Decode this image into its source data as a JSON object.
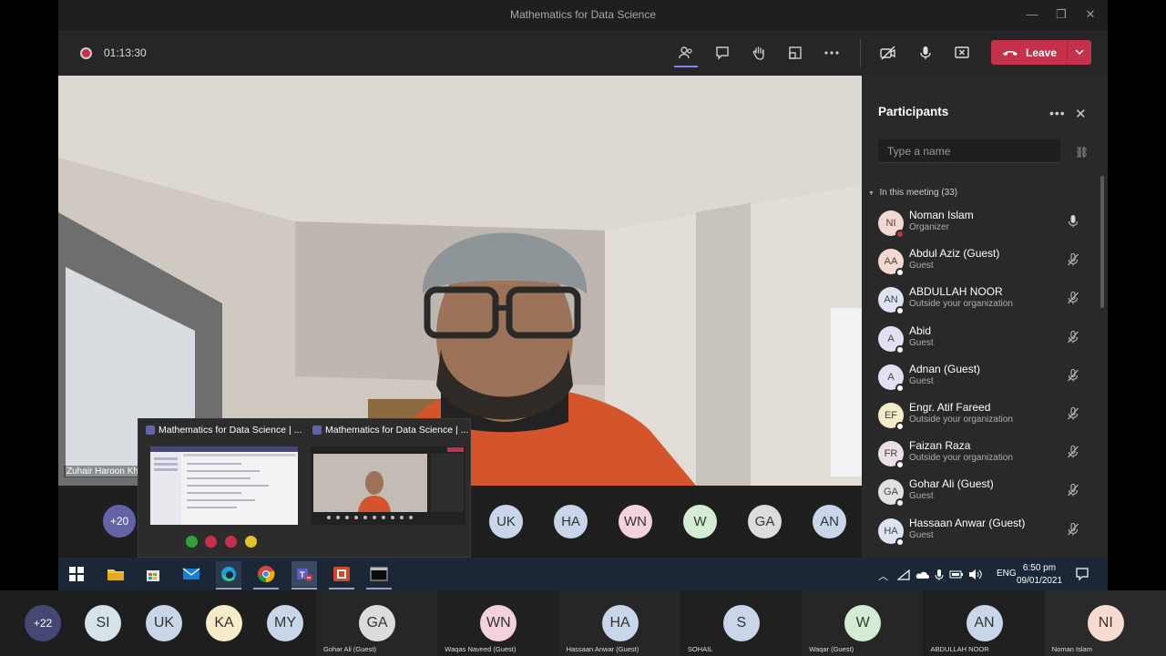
{
  "window": {
    "title": "Mathematics for Data Science"
  },
  "toolbar": {
    "timer": "01:13:30",
    "leave_label": "Leave"
  },
  "video": {
    "speaker_name": "Zuhair Haroon Kh"
  },
  "thumbs": [
    {
      "title": "Mathematics for Data Science | ..."
    },
    {
      "title": "Mathematics for Data Science | ..."
    }
  ],
  "status_colors": [
    "#2fa33a",
    "#c4314b",
    "#c4314b",
    "#e1c42a"
  ],
  "avatar_row": {
    "overflow": "+20",
    "items": [
      {
        "initials": "UK",
        "color": "#c9d6ea"
      },
      {
        "initials": "HA",
        "color": "#c9d6ea"
      },
      {
        "initials": "WN",
        "color": "#f3d2dc"
      },
      {
        "initials": "W",
        "color": "#d4ecd4"
      },
      {
        "initials": "GA",
        "color": "#dcdcdc"
      },
      {
        "initials": "AN",
        "color": "#c9d6ea"
      }
    ]
  },
  "participants": {
    "title": "Participants",
    "search_placeholder": "Type a name",
    "section": "In this meeting (33)",
    "list": [
      {
        "initials": "NI",
        "name": "Noman Islam",
        "role": "Organizer",
        "color": "#f3d9d2",
        "status": "#c4314b",
        "mic": "on"
      },
      {
        "initials": "AA",
        "name": "Abdul Aziz (Guest)",
        "role": "Guest",
        "color": "#f3d9d2",
        "status": "#ffffff",
        "mic": "off"
      },
      {
        "initials": "AN",
        "name": "ABDULLAH NOOR",
        "role": "Outside your organization",
        "color": "#dde3f1",
        "status": "#ffffff",
        "mic": "off"
      },
      {
        "initials": "A",
        "name": "Abid",
        "role": "Guest",
        "color": "#e3e0f3",
        "status": "#ffffff",
        "mic": "off"
      },
      {
        "initials": "A",
        "name": "Adnan (Guest)",
        "role": "Guest",
        "color": "#e3e0f3",
        "status": "#ffffff",
        "mic": "off"
      },
      {
        "initials": "EF",
        "name": "Engr. Atif Fareed",
        "role": "Outside your organization",
        "color": "#f6ecc9",
        "status": "#ffffff",
        "mic": "off"
      },
      {
        "initials": "FR",
        "name": "Faizan Raza",
        "role": "Outside your organization",
        "color": "#ecdfe8",
        "status": "#ffffff",
        "mic": "off"
      },
      {
        "initials": "GA",
        "name": "Gohar Ali (Guest)",
        "role": "Guest",
        "color": "#e2e2e2",
        "status": "#ffffff",
        "mic": "off"
      },
      {
        "initials": "HA",
        "name": "Hassaan Anwar (Guest)",
        "role": "Guest",
        "color": "#dde3f1",
        "status": "#ffffff",
        "mic": "off"
      }
    ]
  },
  "taskbar": {
    "lang": "ENG",
    "time": "6:50 pm",
    "date": "09/01/2021"
  },
  "bottom_strip": {
    "overflow": "+22",
    "small": [
      {
        "initials": "SI",
        "color": "#d6e2ea"
      },
      {
        "initials": "UK",
        "color": "#c9d6ea"
      },
      {
        "initials": "KA",
        "color": "#f6ecc9"
      },
      {
        "initials": "MY",
        "color": "#c9d6ea"
      }
    ],
    "tiles": [
      {
        "initials": "GA",
        "name": "Gohar Ali (Guest)",
        "color": "#dcdcdc"
      },
      {
        "initials": "WN",
        "name": "Waqas Naveed (Guest)",
        "color": "#f3d2dc"
      },
      {
        "initials": "HA",
        "name": "Hassaan Anwar (Guest)",
        "color": "#c9d6ea"
      },
      {
        "initials": "S",
        "name": "SOHAIL",
        "color": "#c9d6ea"
      },
      {
        "initials": "W",
        "name": "Waqar (Guest)",
        "color": "#d4ecd4"
      },
      {
        "initials": "AN",
        "name": "ABDULLAH NOOR",
        "color": "#c9d6ea"
      },
      {
        "initials": "NI",
        "name": "Noman Islam",
        "color": "#f6dcd0"
      }
    ]
  }
}
